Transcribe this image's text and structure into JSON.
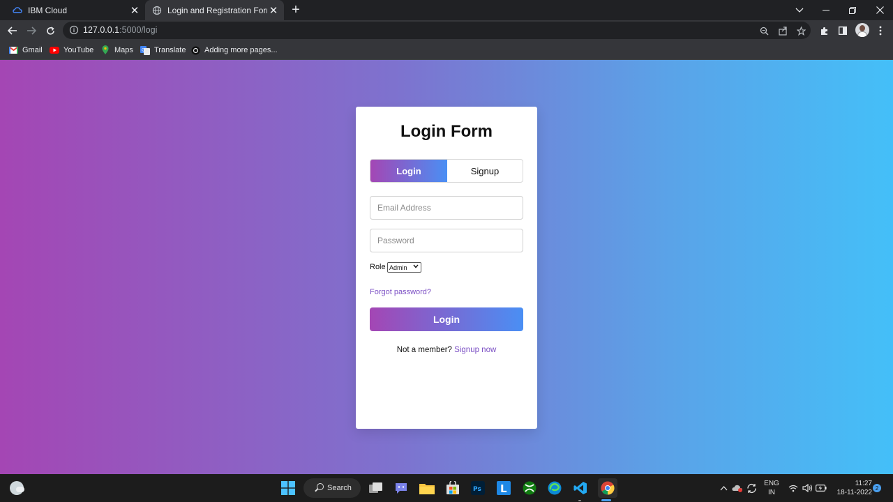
{
  "browser": {
    "tabs": [
      {
        "title": "IBM Cloud",
        "active": false
      },
      {
        "title": "Login and Registration Form",
        "active": true
      }
    ],
    "url_host": "127.0.0.1",
    "url_rest": ":5000/logi",
    "bookmarks": [
      "Gmail",
      "YouTube",
      "Maps",
      "Translate",
      "Adding more pages..."
    ]
  },
  "form": {
    "title": "Login Form",
    "tab_login": "Login",
    "tab_signup": "Signup",
    "email_placeholder": "Email Address",
    "password_placeholder": "Password",
    "role_label": "Role",
    "role_value": "Admin",
    "forgot": "Forgot password?",
    "submit": "Login",
    "not_member": "Not a member?",
    "signup_link": "Signup now"
  },
  "taskbar": {
    "search_label": "Search",
    "lang_line1": "ENG",
    "lang_line2": "IN",
    "time": "11:27",
    "date": "18-11-2022",
    "notifications": "2"
  },
  "colors": {
    "gradient_start": "#a446b4",
    "gradient_end": "#44bff8",
    "accent_button_start": "#a446b4",
    "accent_button_end": "#4a8ff4",
    "link": "#7b4fc4"
  }
}
